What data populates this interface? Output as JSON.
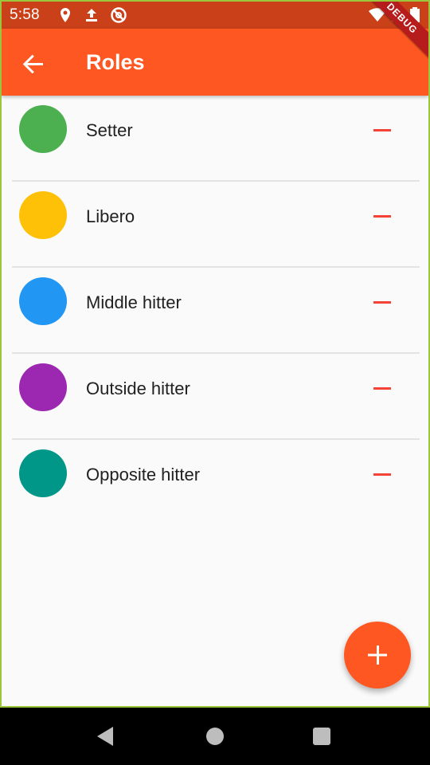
{
  "status_bar": {
    "time": "5:58",
    "icons": [
      "location-pin-icon",
      "upload-icon",
      "do-not-disturb-icon",
      "wifi-icon",
      "signal-icon",
      "battery-icon"
    ]
  },
  "app_bar": {
    "title": "Roles",
    "back_icon": "arrow-back-icon",
    "color": "#ff5722",
    "debug_banner": "DEBUG"
  },
  "roles": [
    {
      "name": "Setter",
      "color": "#4caf50"
    },
    {
      "name": "Libero",
      "color": "#ffc107"
    },
    {
      "name": "Middle hitter",
      "color": "#2196f3"
    },
    {
      "name": "Outside hitter",
      "color": "#9c27b0"
    },
    {
      "name": "Opposite hitter",
      "color": "#009688"
    }
  ],
  "remove_icon": "minus-icon",
  "remove_color": "#f44336",
  "fab": {
    "icon": "plus-icon",
    "color": "#ff5722"
  },
  "nav_bar": {
    "icons": [
      "back-triangle-icon",
      "home-circle-icon",
      "recents-square-icon"
    ]
  }
}
